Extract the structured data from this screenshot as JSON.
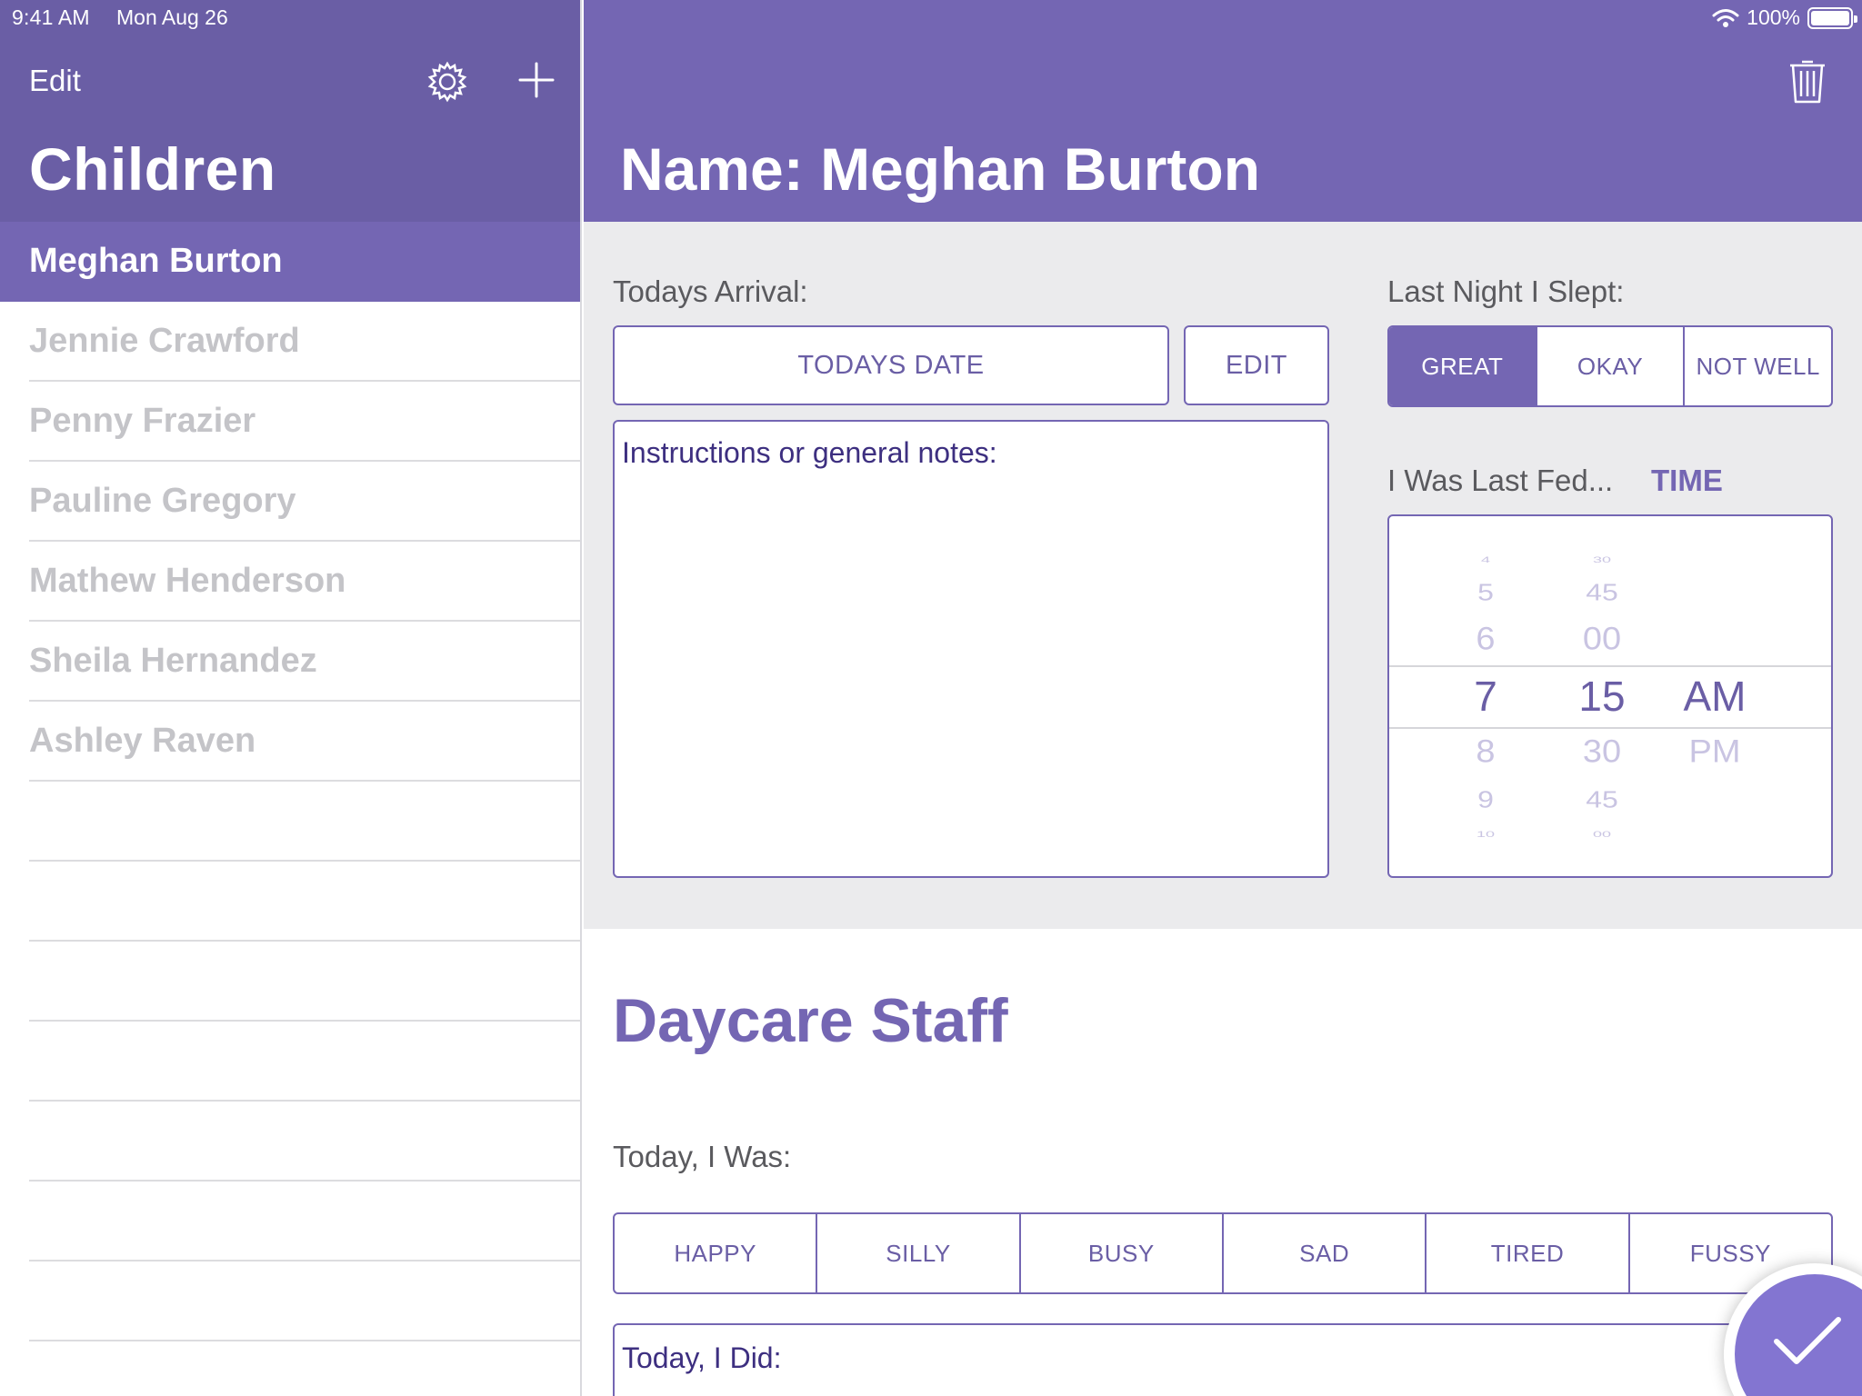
{
  "status_bar": {
    "time": "9:41 AM",
    "date": "Mon Aug 26",
    "battery": "100%"
  },
  "sidebar": {
    "edit_label": "Edit",
    "title": "Children",
    "children": [
      {
        "name": "Meghan Burton",
        "selected": true
      },
      {
        "name": "Jennie Crawford",
        "selected": false
      },
      {
        "name": "Penny Frazier",
        "selected": false
      },
      {
        "name": "Pauline Gregory",
        "selected": false
      },
      {
        "name": "Mathew Henderson",
        "selected": false
      },
      {
        "name": "Sheila Hernandez",
        "selected": false
      },
      {
        "name": "Ashley Raven",
        "selected": false
      }
    ]
  },
  "detail": {
    "title": "Name: Meghan Burton",
    "arrival": {
      "label": "Todays Arrival:",
      "date_button": "TODAYS DATE",
      "edit_button": "EDIT",
      "notes_placeholder": "Instructions or general notes:"
    },
    "sleep": {
      "label": "Last Night I Slept:",
      "options": [
        "GREAT",
        "OKAY",
        "NOT WELL"
      ],
      "selected": "GREAT"
    },
    "fed": {
      "label": "I Was Last Fed...",
      "time_link": "TIME",
      "picker": {
        "hours": [
          "4",
          "5",
          "6",
          "7",
          "8",
          "9",
          "10"
        ],
        "minutes": [
          "30",
          "45",
          "00",
          "15",
          "30",
          "45",
          "00"
        ],
        "period": [
          "AM",
          "PM"
        ],
        "selected": {
          "hour": "7",
          "minute": "15",
          "period": "AM"
        }
      }
    },
    "staff": {
      "title": "Daycare Staff",
      "mood_label": "Today, I Was:",
      "moods": [
        "HAPPY",
        "SILLY",
        "BUSY",
        "SAD",
        "TIRED",
        "FUSSY"
      ],
      "did_placeholder": "Today, I Did:"
    }
  },
  "colors": {
    "accent": "#7466b3",
    "sidebar_header": "#6a5ea5",
    "panel": "#ebebed"
  }
}
